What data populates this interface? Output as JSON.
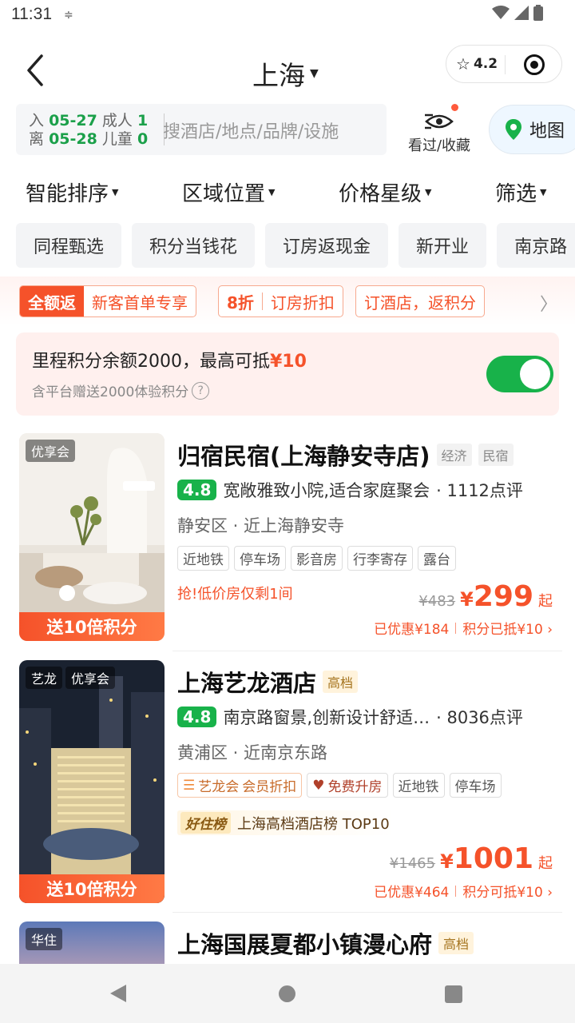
{
  "status_bar": {
    "time": "11:31"
  },
  "header": {
    "city": "上海",
    "mini_rating": "4.2"
  },
  "search": {
    "checkin_label": "入",
    "checkin_date": "05-27",
    "adults_label": "成人",
    "adults": "1",
    "checkout_label": "离",
    "checkout_date": "05-28",
    "children_label": "儿童",
    "children": "0",
    "placeholder": "搜酒店/地点/品牌/设施",
    "favorites_label": "看过/收藏",
    "map_label": "地图"
  },
  "filters": [
    "智能排序",
    "区域位置",
    "价格星级",
    "筛选"
  ],
  "chips": [
    "同程甄选",
    "积分当钱花",
    "订房返现金",
    "新开业",
    "南京路"
  ],
  "promos": {
    "p1_badge": "全额返",
    "p1_text": "新客首单专享",
    "p2_badge": "8折",
    "p2_text": "订房折扣",
    "p3_text": "订酒店，返积分"
  },
  "mileage": {
    "title_prefix": "里程积分余额2000，最高可抵",
    "amount": "¥10",
    "subtitle": "含平台赠送2000体验积分",
    "toggle_on": true
  },
  "hotels": [
    {
      "badges": [
        "优享会"
      ],
      "banner": "送10倍积分",
      "name": "归宿民宿(上海静安寺店)",
      "grades": [
        "经济",
        "民宿"
      ],
      "score": "4.8",
      "review": "宽敞雅致小院,适合家庭聚会",
      "review_count": "· 1112点评",
      "location": "静安区 · 近上海静安寺",
      "tags": [
        "近地铁",
        "停车场",
        "影音房",
        "行李寄存",
        "露台"
      ],
      "urgent": "抢!低价房仅剩1间",
      "orig_price": "¥483",
      "currency": "¥",
      "price": "299",
      "price_suffix": "起",
      "discount": "已优惠¥184",
      "points": "积分已抵¥10 ›"
    },
    {
      "badges": [
        "艺龙",
        "优享会"
      ],
      "banner": "送10倍积分",
      "name": "上海艺龙酒店",
      "grade": "高档",
      "score": "4.8",
      "review": "南京路窗景,创新设计舒适…",
      "review_count": "· 8036点评",
      "location": "黄浦区 · 近南京东路",
      "brand_tag_name": "艺龙会",
      "brand_tag_text": "会员折扣",
      "upgrade_tag": "免费升房",
      "tags": [
        "近地铁",
        "停车场"
      ],
      "ranking_logo": "好住榜",
      "ranking_text": "上海高档酒店榜 TOP10",
      "orig_price": "¥1465",
      "currency": "¥",
      "price": "1001",
      "price_suffix": "起",
      "discount": "已优惠¥464",
      "points": "积分可抵¥10 ›"
    },
    {
      "badges": [
        "华住"
      ],
      "name": "上海国展夏都小镇漫心府",
      "grade": "高档"
    }
  ]
}
